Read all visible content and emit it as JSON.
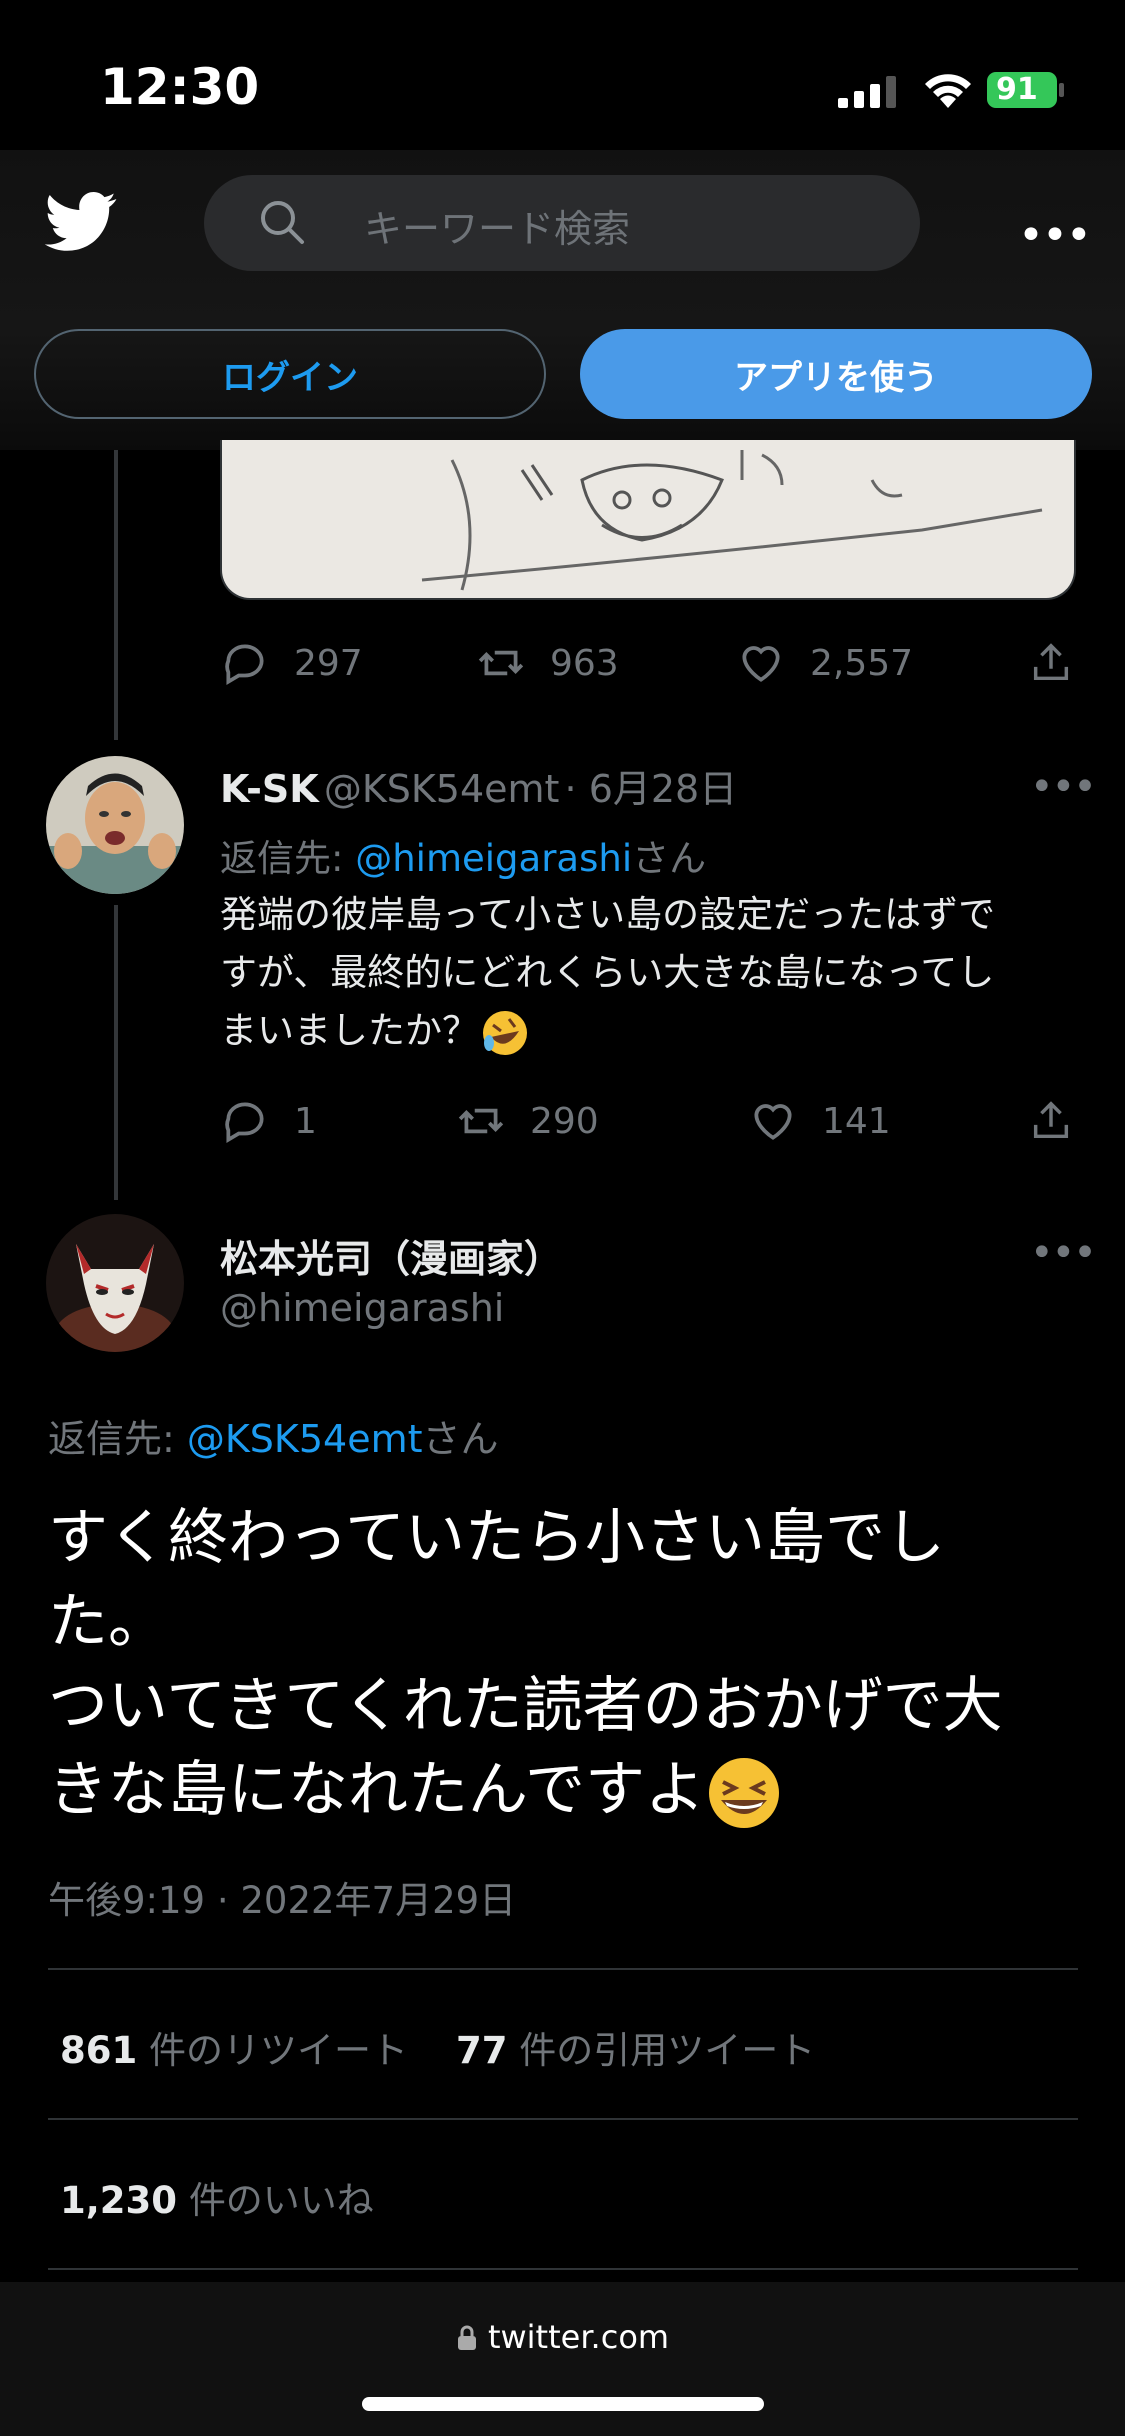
{
  "status_bar": {
    "time": "12:30",
    "battery": "91"
  },
  "header": {
    "search_placeholder": "キーワード検索",
    "login_label": "ログイン",
    "app_label": "アプリを使う"
  },
  "prev_tweet_actions": {
    "replies": "297",
    "retweets": "963",
    "likes": "2,557"
  },
  "reply_tweet": {
    "name": "K-SK",
    "handle": "@KSK54emt",
    "date": "· 6月28日",
    "reply_to_prefix": "返信先: ",
    "reply_to_handle": "@himeigarashi",
    "reply_to_suffix": "さん",
    "text_line1": "発端の彼岸島って小さい島の設定だったはずで",
    "text_line2": "すが、最終的にどれくらい大きな島になってし",
    "text_line3": "まいましたか？",
    "replies": "1",
    "retweets": "290",
    "likes": "141"
  },
  "main_tweet": {
    "name": "松本光司（漫画家）",
    "handle": "@himeigarashi",
    "reply_to_prefix": "返信先: ",
    "reply_to_handle": "@KSK54emt",
    "reply_to_suffix": "さん",
    "text_line1": "すく終わっていたら小さい島でし",
    "text_line2": "た。",
    "text_line3": "ついてきてくれた読者のおかげで大",
    "text_line4": "きな島になれたんですよ",
    "timestamp": "午後9:19 · 2022年7月29日",
    "retweet_count": "861",
    "retweet_label": "件のリツイート",
    "quote_count": "77",
    "quote_label": "件の引用ツイート",
    "like_count": "1,230",
    "like_label": "件のいいね"
  },
  "browser": {
    "url": "twitter.com"
  },
  "colors": {
    "accent": "#1d9bf0",
    "background": "#000000",
    "app_button": "#4a9ae8",
    "battery": "#34c759"
  }
}
